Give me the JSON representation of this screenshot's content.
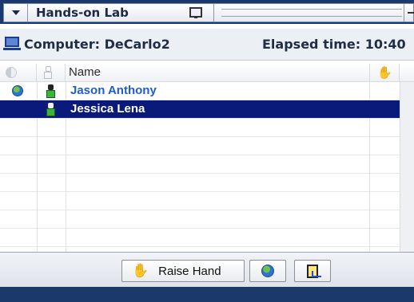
{
  "window": {
    "title": "Hands-on Lab"
  },
  "info": {
    "computer": "Computer: DeCarlo2",
    "elapsed": "Elapsed time: 10:40"
  },
  "grid": {
    "columns": [
      "",
      "",
      "Name",
      ""
    ],
    "rows": [
      {
        "name": "Jason Anthony",
        "selected": false,
        "has_globe": true
      },
      {
        "name": "Jessica Lena",
        "selected": true,
        "has_globe": false
      }
    ]
  },
  "toolbar": {
    "raise_hand_label": "Raise Hand"
  },
  "colors": {
    "selection": "#0a1a7a",
    "name_link": "#1e5bd6",
    "frame": "#1b3a6b"
  },
  "icons": [
    "menu-arrow-icon",
    "monitor-icon",
    "computer-icon",
    "status-half-icon",
    "person-outline-icon",
    "hand-icon",
    "globe-icon",
    "person-icon",
    "document-arrow-icon"
  ]
}
